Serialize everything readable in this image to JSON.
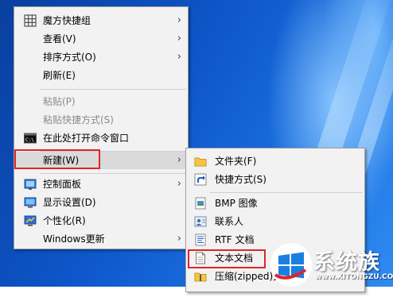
{
  "main_menu": {
    "items": [
      {
        "label": "魔方快捷组",
        "icon": "grid-icon",
        "arrow": "›"
      },
      {
        "label": "查看(V)",
        "arrow": "›"
      },
      {
        "label": "排序方式(O)",
        "arrow": "›"
      },
      {
        "label": "刷新(E)"
      },
      {
        "label": "粘贴(P)"
      },
      {
        "label": "粘贴快捷方式(S)"
      },
      {
        "label": "在此处打开命令窗口",
        "icon": "cmd-icon"
      },
      {
        "label": "新建(W)",
        "arrow": "›"
      },
      {
        "label": "控制面板",
        "icon": "control-panel-icon",
        "arrow": "›"
      },
      {
        "label": "显示设置(D)",
        "icon": "display-settings-icon"
      },
      {
        "label": "个性化(R)",
        "icon": "personalize-icon"
      },
      {
        "label": "Windows更新",
        "arrow": "›"
      }
    ]
  },
  "sub_menu": {
    "items": [
      {
        "label": "文件夹(F)",
        "icon": "folder-icon"
      },
      {
        "label": "快捷方式(S)",
        "icon": "shortcut-icon"
      },
      {
        "label": "BMP 图像",
        "icon": "bmp-file-icon"
      },
      {
        "label": "联系人",
        "icon": "contact-icon"
      },
      {
        "label": "RTF 文档",
        "icon": "rtf-file-icon"
      },
      {
        "label": "文本文档",
        "icon": "text-file-icon"
      },
      {
        "label": "压缩(zipped)文",
        "icon": "zip-folder-icon"
      }
    ]
  },
  "watermark": {
    "brand": "系统族",
    "url": "www.XITONGZU.COM"
  },
  "colors": {
    "highlight_box": "#e0242a",
    "menu_bg": "#f2f2f2"
  }
}
